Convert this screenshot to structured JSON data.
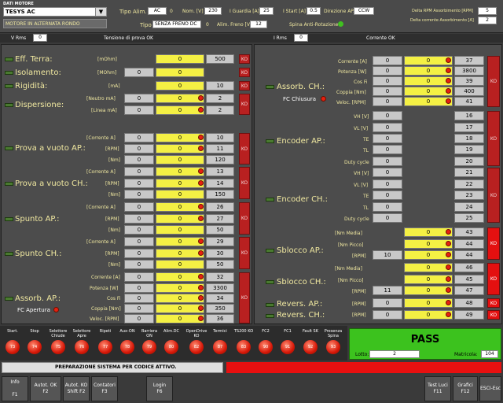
{
  "header": {
    "section": "DATI MOTORE",
    "motor_select": "TESYS AC",
    "mode_label": "MOTORE IN ALTERNATA RONDO",
    "tipo_alim_label": "Tipo Alim.",
    "tipo_alim_value": "AC",
    "tipo_alim_num": "0",
    "nom_v_label": "Nom. [V]",
    "nom_v_value": "230",
    "iguardia_label": "I Guardia [A]",
    "iguardia_value": "25",
    "istart_label": "I Start [A]",
    "istart_value": "0.5",
    "direzione_label": "Direzione AP.",
    "direzione_value": "CCW",
    "delta_rpm_label": "Delta RPM Assorbimento [RPM]",
    "delta_rpm_value": "5",
    "delta_corr_label": "Delta corrente Assorbimento [A]",
    "delta_corr_value": "2",
    "tipo_label": "Tipo",
    "tipo_value": "SENZA FRENO DC",
    "tipo_num": "0",
    "alim_freno_label": "Alim. Freno [V]",
    "alim_freno_value": "12",
    "spina_label": "Spina Anti-Rotazione"
  },
  "status_bar": {
    "vrms_label": "V Rms",
    "vrms_value": "0",
    "tensione_label": "Tensione di prova OK",
    "irms_label": "I Rms",
    "irms_value": "0",
    "corrente_label": "Corrente OK"
  },
  "left": {
    "eff_terra": {
      "title": "Eff. Terra:",
      "unit": "[mOhm]",
      "value": "0",
      "limit": "500",
      "ko": "KO"
    },
    "isolamento": {
      "title": "Isolamento:",
      "unit": "[MOhm]",
      "measure": "0",
      "value": "0",
      "ko": "KO"
    },
    "rigidita": {
      "title": "Rigidità:",
      "unit": "[mA]",
      "value": "0",
      "limit": "10",
      "ko": "KO"
    },
    "dispersione": {
      "title": "Dispersione:",
      "rows": [
        {
          "unit": "[Neutro mA]",
          "m": "0",
          "v": "0",
          "l": "2"
        },
        {
          "unit": "[Linea mA]",
          "m": "0",
          "v": "0",
          "l": "2"
        }
      ],
      "ko": "KO"
    },
    "vuoto_ap": {
      "title": "Prova a vuoto AP.:",
      "rows": [
        {
          "unit": "[Corrente A]",
          "m": "0",
          "v": "0",
          "l": "10"
        },
        {
          "unit": "[RPM]",
          "m": "0",
          "v": "0",
          "l": "11"
        },
        {
          "unit": "[Nm]",
          "m": "0",
          "v": "0",
          "l": "120"
        }
      ],
      "ko": "KO"
    },
    "vuoto_ch": {
      "title": "Prova a vuoto CH.:",
      "rows": [
        {
          "unit": "[Corrente A]",
          "m": "0",
          "v": "0",
          "l": "13"
        },
        {
          "unit": "[RPM]",
          "m": "0",
          "v": "0",
          "l": "14"
        },
        {
          "unit": "[Nm]",
          "m": "0",
          "v": "0",
          "l": "150"
        }
      ],
      "ko": "KO"
    },
    "spunto_ap": {
      "title": "Spunto AP.:",
      "rows": [
        {
          "unit": "[Corrente A]",
          "m": "0",
          "v": "0",
          "l": "26"
        },
        {
          "unit": "[RPM]",
          "m": "0",
          "v": "0",
          "l": "27"
        },
        {
          "unit": "[Nm]",
          "m": "0",
          "v": "0",
          "l": "50"
        }
      ],
      "ko": "KO"
    },
    "spunto_ch": {
      "title": "Spunto CH.:",
      "rows": [
        {
          "unit": "[Corrente A]",
          "m": "0",
          "v": "0",
          "l": "29"
        },
        {
          "unit": "[RPM]",
          "m": "0",
          "v": "0",
          "l": "30"
        },
        {
          "unit": "[Nm]",
          "m": "0",
          "v": "0",
          "l": "50"
        }
      ],
      "ko": "KO"
    },
    "assorb_ap": {
      "title": "Assorb. AP.:",
      "fc": "FC Apertura",
      "rows": [
        {
          "unit": "Corrente [A]",
          "m": "0",
          "v": "0",
          "l": "32"
        },
        {
          "unit": "Potenza [W]",
          "m": "0",
          "v": "0",
          "l": "3300"
        },
        {
          "unit": "Cos Fi",
          "m": "0",
          "v": "0",
          "l": "34"
        },
        {
          "unit": "Coppia [Nm]",
          "m": "0",
          "v": "0",
          "l": "350"
        },
        {
          "unit": "Veloc. [RPM]",
          "m": "0",
          "v": "0",
          "l": "36"
        }
      ],
      "ko": "KO"
    }
  },
  "right": {
    "assorb_ch": {
      "title": "Assorb. CH.:",
      "fc": "FC Chiusura",
      "rows": [
        {
          "unit": "Corrente [A]",
          "m": "0",
          "v": "0",
          "l": "37"
        },
        {
          "unit": "Potenza [W]",
          "m": "0",
          "v": "0",
          "l": "3800"
        },
        {
          "unit": "Cos Fi",
          "m": "0",
          "v": "0",
          "l": "39"
        },
        {
          "unit": "Coppia [Nm]",
          "m": "0",
          "v": "0",
          "l": "400"
        },
        {
          "unit": "Veloc. [RPM]",
          "m": "0",
          "v": "0",
          "l": "41"
        }
      ],
      "ko": "KO"
    },
    "encoder_ap": {
      "title": "Encoder AP.:",
      "rows": [
        {
          "unit": "VH [V]",
          "m": "0",
          "l": "16"
        },
        {
          "unit": "VL [V]",
          "m": "0",
          "l": "17"
        },
        {
          "unit": "TE",
          "m": "0",
          "l": "18"
        },
        {
          "unit": "TL",
          "m": "0",
          "l": "19"
        },
        {
          "unit": "Duty cycle",
          "m": "0",
          "l": "20"
        }
      ],
      "ko": "KO"
    },
    "encoder_ch": {
      "title": "Encoder CH.:",
      "rows": [
        {
          "unit": "VH [V]",
          "m": "0",
          "l": "21"
        },
        {
          "unit": "VL [V]",
          "m": "0",
          "l": "22"
        },
        {
          "unit": "TE",
          "m": "0",
          "l": "23"
        },
        {
          "unit": "TL",
          "m": "0",
          "l": "24"
        },
        {
          "unit": "Duty cycle",
          "m": "0",
          "l": "25"
        }
      ],
      "ko": "KO"
    },
    "sblocco_ap": {
      "title": "Sblocco AP.:",
      "rows": [
        {
          "unit": "[Nm Media]",
          "m": "",
          "v": "0",
          "l": "43"
        },
        {
          "unit": "[Nm Picco]",
          "m": "",
          "v": "0",
          "l": "44"
        },
        {
          "unit": "[RPM]",
          "m": "10",
          "v": "0",
          "l": "44"
        }
      ],
      "ko": "KO"
    },
    "sblocco_ch": {
      "title": "Sblocco CH.:",
      "rows": [
        {
          "unit": "[Nm Media]",
          "m": "",
          "v": "0",
          "l": "46"
        },
        {
          "unit": "[Nm Picco]",
          "m": "",
          "v": "0",
          "l": "45"
        },
        {
          "unit": "[RPM]",
          "m": "11",
          "v": "0",
          "l": "47"
        }
      ],
      "ko": "KO"
    },
    "revers_ap": {
      "title": "Revers. AP.:",
      "unit": "[RPM]",
      "m": "0",
      "v": "0",
      "l": "48",
      "ko": "KO"
    },
    "revers_ch": {
      "title": "Revers. CH.:",
      "unit": "[RPM]",
      "m": "0",
      "v": "0",
      "l": "49",
      "ko": "KO"
    }
  },
  "signals": [
    {
      "label": "Start.",
      "n": "73"
    },
    {
      "label": "Stop",
      "n": "74"
    },
    {
      "label": "Selettore Chiude",
      "n": "75"
    },
    {
      "label": "Selettore Apre",
      "n": "76"
    },
    {
      "label": "Ripeti",
      "n": "77"
    },
    {
      "label": "Aux-ON",
      "n": "78"
    },
    {
      "label": "Barriera ON",
      "n": "79"
    },
    {
      "label": "Alim.DC",
      "n": "80"
    },
    {
      "label": "OpenDrive KO",
      "n": "82"
    },
    {
      "label": "Termici",
      "n": "87"
    },
    {
      "label": "TS200 KO",
      "n": "83"
    },
    {
      "label": "FC2",
      "n": "90"
    },
    {
      "label": "FC1",
      "n": "91"
    },
    {
      "label": "Fault SK",
      "n": "92"
    },
    {
      "label": "Presenza Spina",
      "n": "93"
    }
  ],
  "result": {
    "status": "PASS",
    "lotto_label": "Lotto:",
    "lotto_value": "2",
    "matricola_label": "Matricola:",
    "matricola_value": "104"
  },
  "message": "PREPARAZIONE SISTEMA PER CODICE ATTIVO.",
  "buttons": [
    {
      "l1": "Info",
      "l2": "F1"
    },
    {
      "l1": "Autot. OK",
      "l2": "F2"
    },
    {
      "l1": "Autot. KO",
      "l2": "Shift F2"
    },
    {
      "l1": "Contatori",
      "l2": "F3"
    },
    {
      "l1": "Login",
      "l2": "F6"
    },
    {
      "l1": "Test Luci",
      "l2": "F11"
    },
    {
      "l1": "Grafici",
      "l2": "F12"
    },
    {
      "l1": "ESCI-Esc",
      "l2": ""
    }
  ],
  "colors": {
    "bg": "#3a3a3a",
    "yellow": "#f4f044",
    "ko_red": "#b82020",
    "pass_green": "#40c020",
    "message_red": "#e81010"
  }
}
